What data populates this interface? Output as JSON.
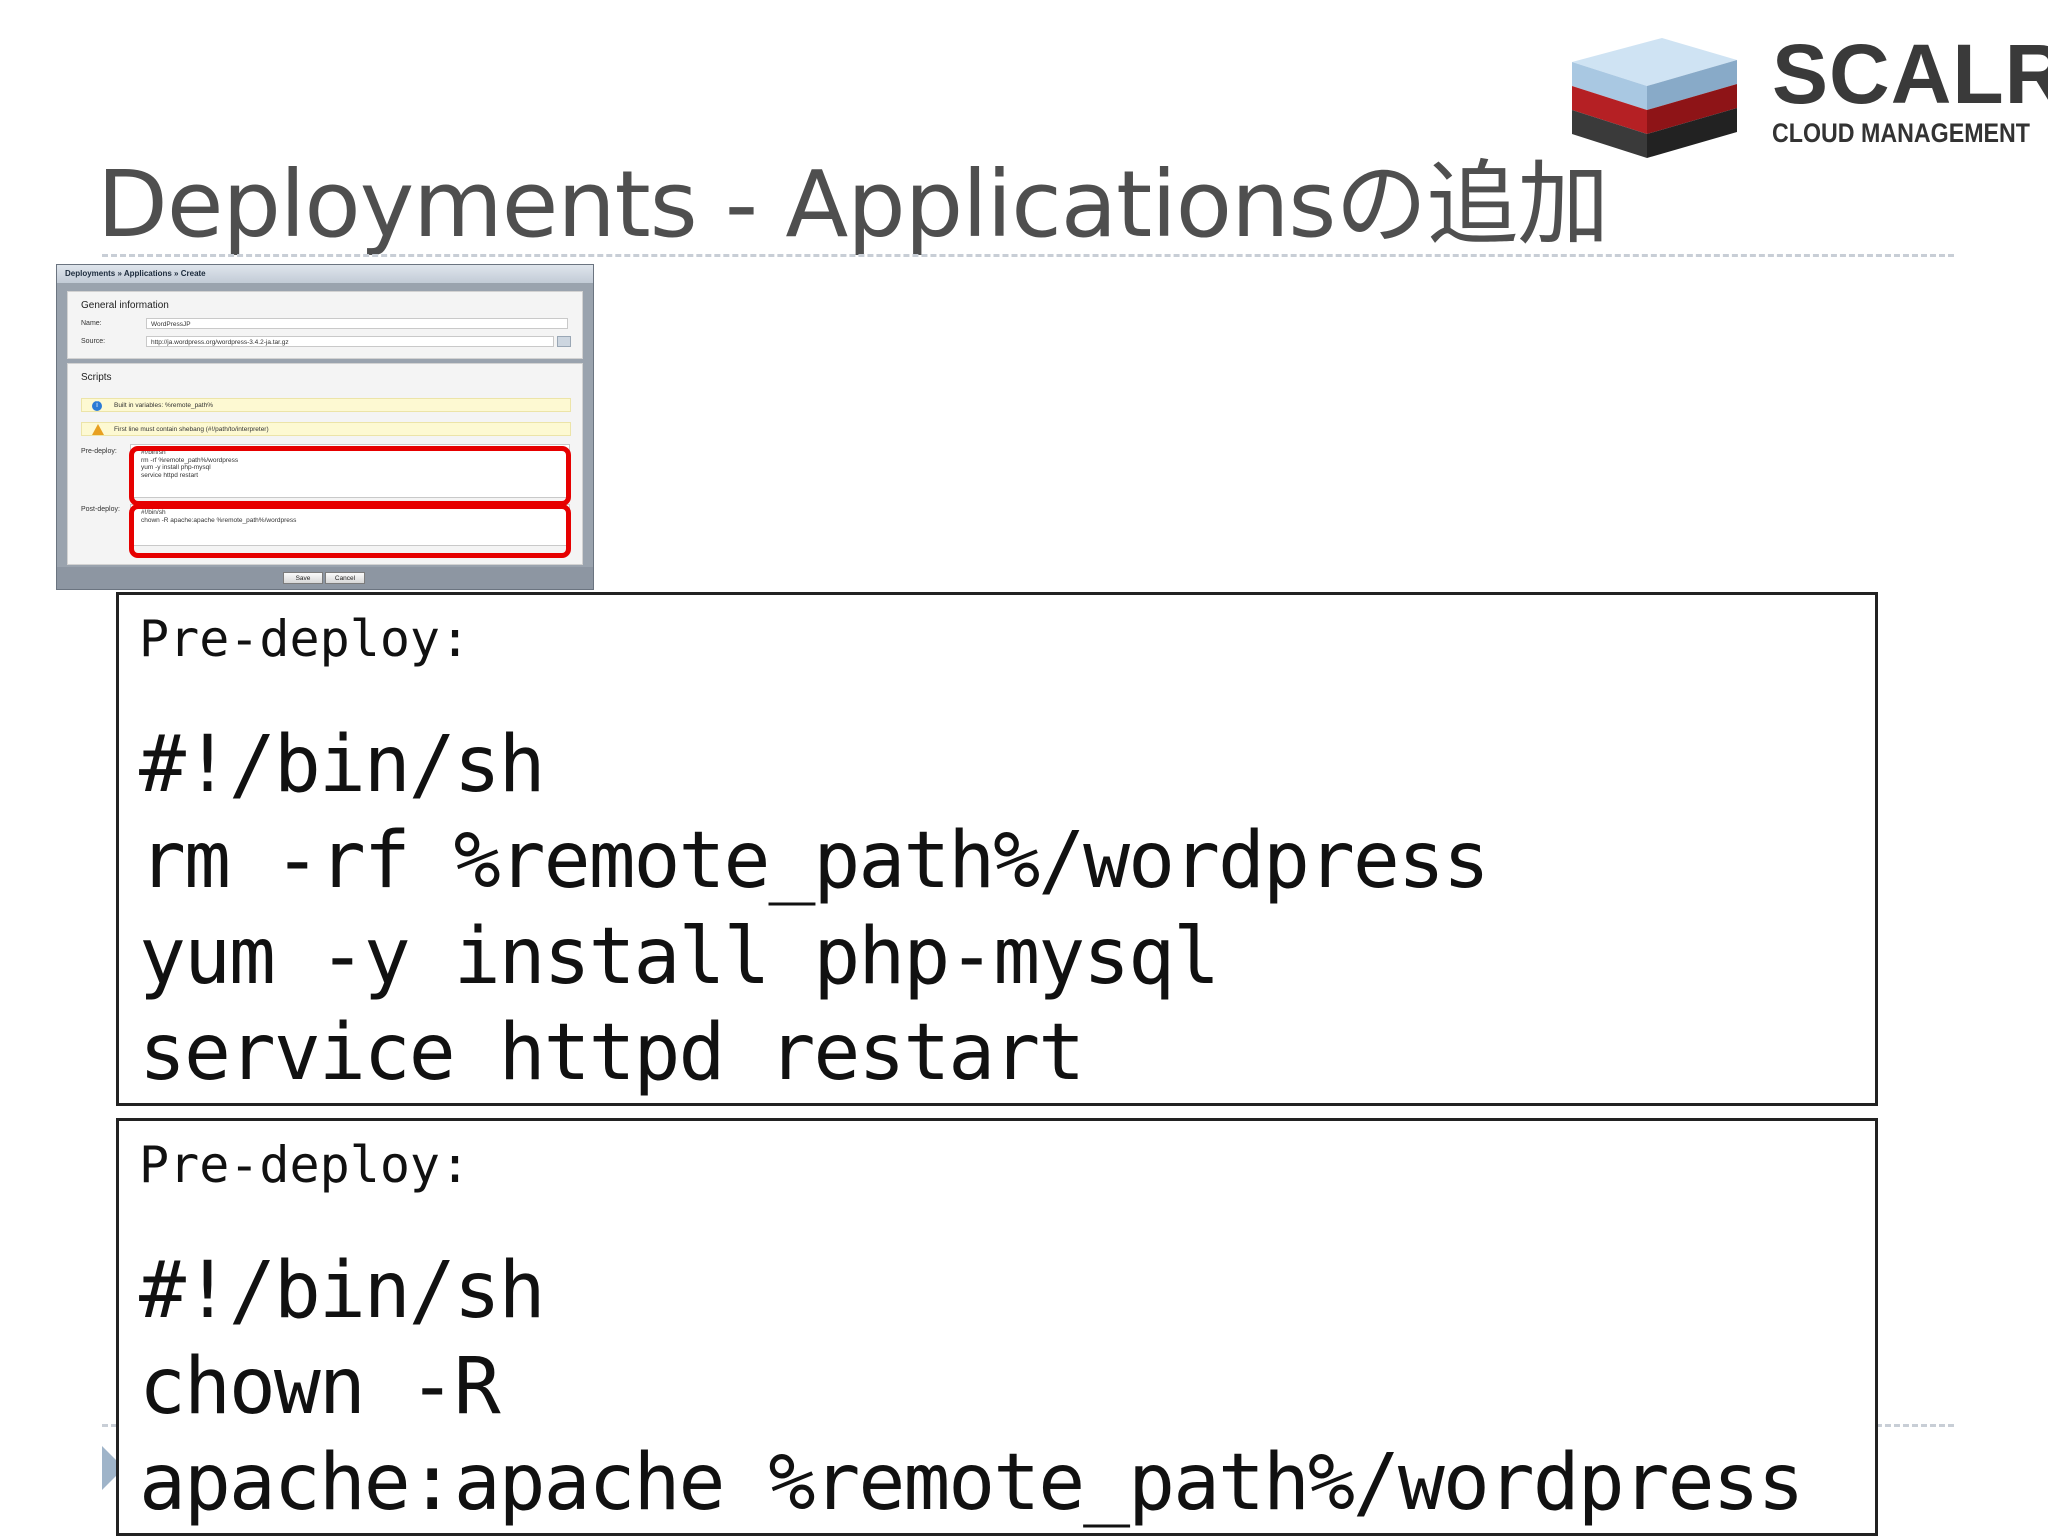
{
  "slide": {
    "title": "Deployments - Applicationsの追加"
  },
  "logo": {
    "name": "SCALR",
    "tagline": "CLOUD MANAGEMENT"
  },
  "screenshot": {
    "breadcrumb": "Deployments » Applications » Create",
    "general_section": "General information",
    "name_label": "Name:",
    "name_value": "WordPressJP",
    "source_label": "Source:",
    "source_value": "http://ja.wordpress.org/wordpress-3.4.2-ja.tar.gz",
    "scripts_section": "Scripts",
    "info_note": "Built in variables: %remote_path%",
    "warning_note": "First line must contain shebang (#!/path/to/interpreter)",
    "predeploy_label": "Pre-deploy:",
    "predeploy_text": "#!/bin/sh\nrm -rf %remote_path%/wordpress\nyum -y install php-mysql\nservice httpd restart",
    "postdeploy_label": "Post-deploy:",
    "postdeploy_text": "#!/bin/sh\nchown -R apache:apache %remote_path%/wordpress",
    "save_label": "Save",
    "cancel_label": "Cancel"
  },
  "code_boxes": [
    {
      "caption": "Pre-deploy:",
      "code": "#!/bin/sh\nrm -rf %remote_path%/wordpress\nyum -y install php-mysql\nservice httpd restart"
    },
    {
      "caption": "Pre-deploy:",
      "code": "#!/bin/sh\nchown -R\napache:apache %remote_path%/wordpress"
    }
  ],
  "colors": {
    "title": "#4f4f4f",
    "highlight": "#e60000",
    "divider": "#c8ced6"
  }
}
